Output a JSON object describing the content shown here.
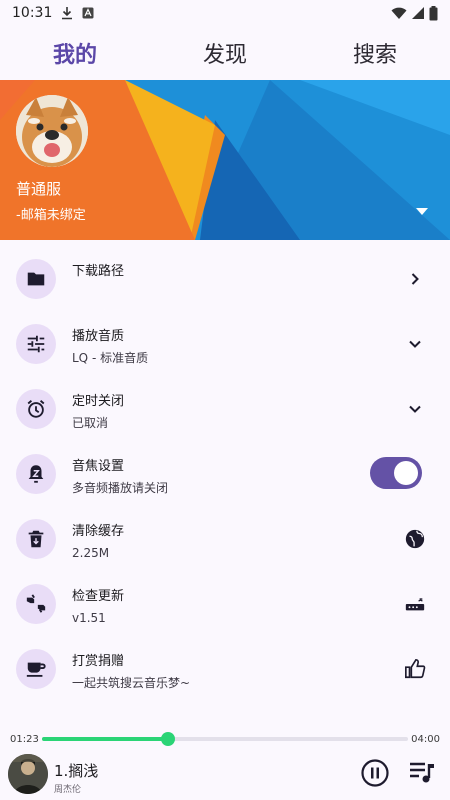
{
  "status_bar": {
    "time": "10:31"
  },
  "tabs": [
    {
      "label": "我的",
      "active": true
    },
    {
      "label": "发现",
      "active": false
    },
    {
      "label": "搜索",
      "active": false
    }
  ],
  "profile": {
    "name": "普通服",
    "email": "-邮箱未绑定"
  },
  "settings": [
    {
      "title": "下载路径",
      "subtitle": "",
      "icon": "folder-icon",
      "trailing": "chevron-right-icon"
    },
    {
      "title": "播放音质",
      "subtitle": "LQ - 标准音质",
      "icon": "tune-icon",
      "trailing": "chevron-down-icon"
    },
    {
      "title": "定时关闭",
      "subtitle": "已取消",
      "icon": "alarm-icon",
      "trailing": "chevron-down-icon"
    },
    {
      "title": "音焦设置",
      "subtitle": "多音频播放请关闭",
      "icon": "notification-z-icon",
      "trailing": "toggle-switch",
      "toggle_on": true
    },
    {
      "title": "清除缓存",
      "subtitle": "2.25M",
      "icon": "delete-icon",
      "trailing": "globe-icon"
    },
    {
      "title": "检查更新",
      "subtitle": "v1.51",
      "icon": "thumbs-up-down-icon",
      "trailing": "router-icon"
    },
    {
      "title": "打赏捐赠",
      "subtitle": "一起共筑搜云音乐梦~",
      "icon": "coffee-cup-icon",
      "trailing": "thumb-up-icon"
    }
  ],
  "player": {
    "current_time": "01:23",
    "total_time": "04:00",
    "progress": 0.345,
    "song_title": "1.搁浅",
    "artist": "周杰伦"
  },
  "colors": {
    "accent": "#5b47a8",
    "icon_bg": "#e9ddf7",
    "progress": "#2bd476",
    "banner_orange": "#f0742a",
    "banner_yellow": "#f5b21d",
    "banner_blue": "#1e90d8"
  }
}
